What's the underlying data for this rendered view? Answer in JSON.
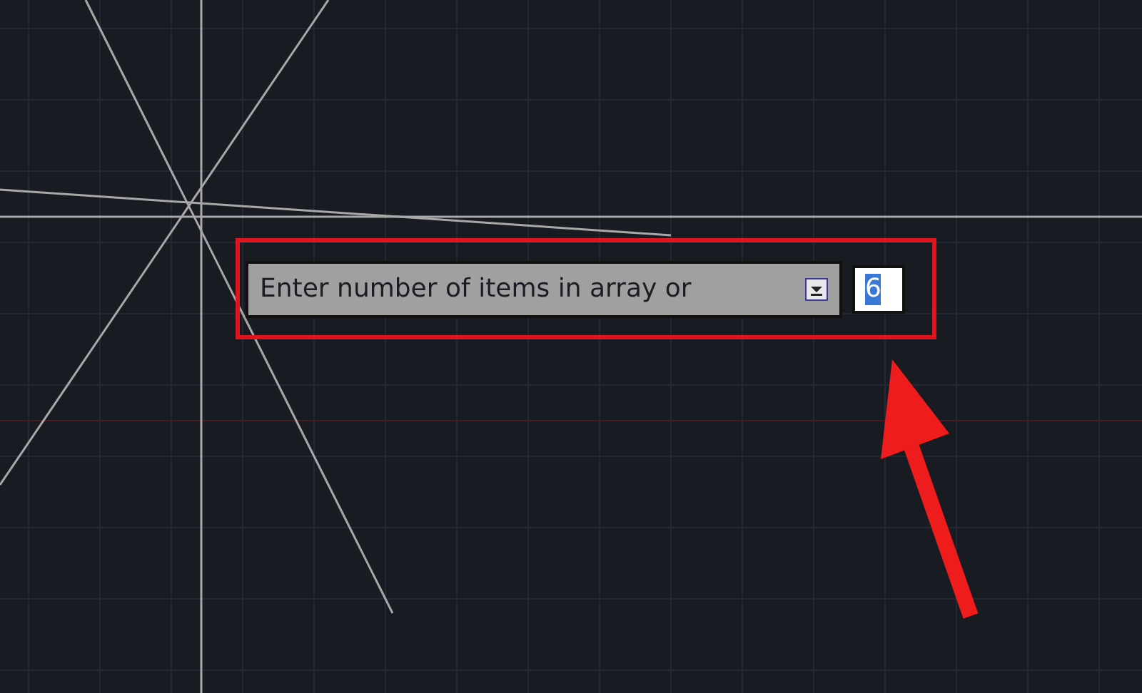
{
  "prompt": {
    "text": "Enter number of items in array or"
  },
  "input": {
    "value": "6",
    "selected": true
  }
}
